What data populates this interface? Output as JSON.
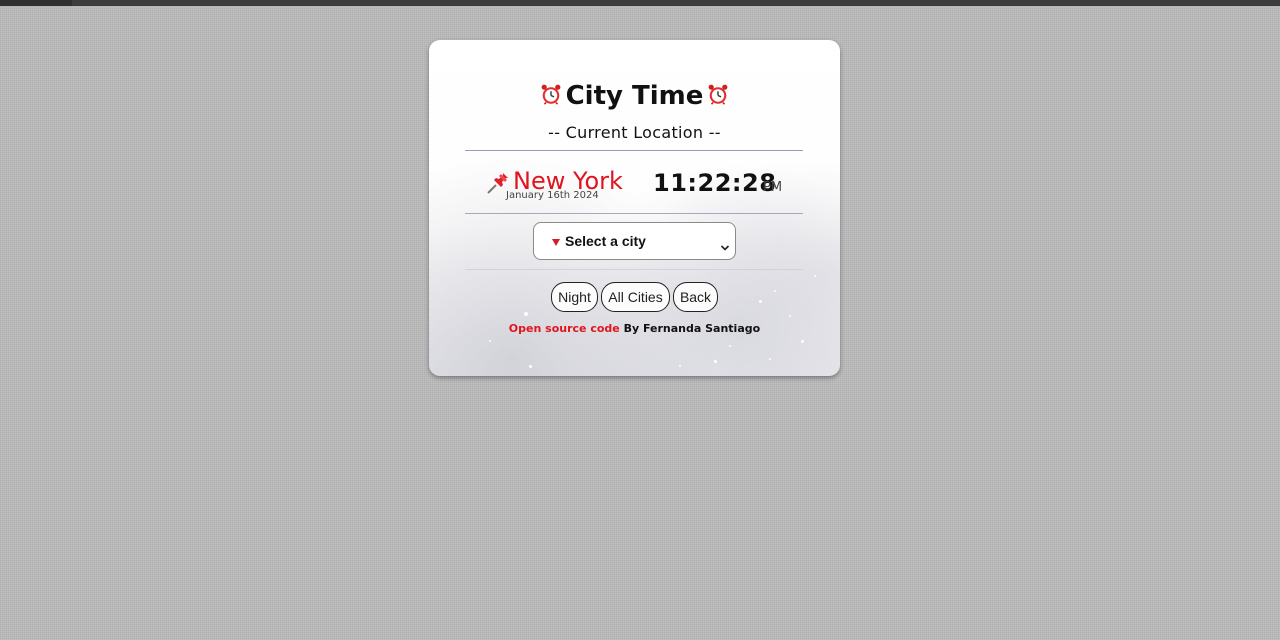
{
  "app": {
    "title": "City Time",
    "subtitle": "-- Current Location --"
  },
  "current_city": {
    "name": "New York",
    "date": "January 16th 2024",
    "time": "11:22:28",
    "period": "PM"
  },
  "city_select": {
    "selected_label": "Select a city"
  },
  "buttons": {
    "night": "Night",
    "all_cities": "All Cities",
    "back": "Back"
  },
  "footer": {
    "link_text": "Open source code",
    "author_text": "By Fernanda Santiago"
  },
  "colors": {
    "accent_red": "#e0141e",
    "background_gray": "#b9b9b9"
  },
  "icons": {
    "title_left": "alarm-clock-icon",
    "title_right": "alarm-clock-icon",
    "city": "pushpin-icon",
    "select_marker": "red-triangle-icon",
    "select_dropdown": "chevron-down-icon"
  }
}
